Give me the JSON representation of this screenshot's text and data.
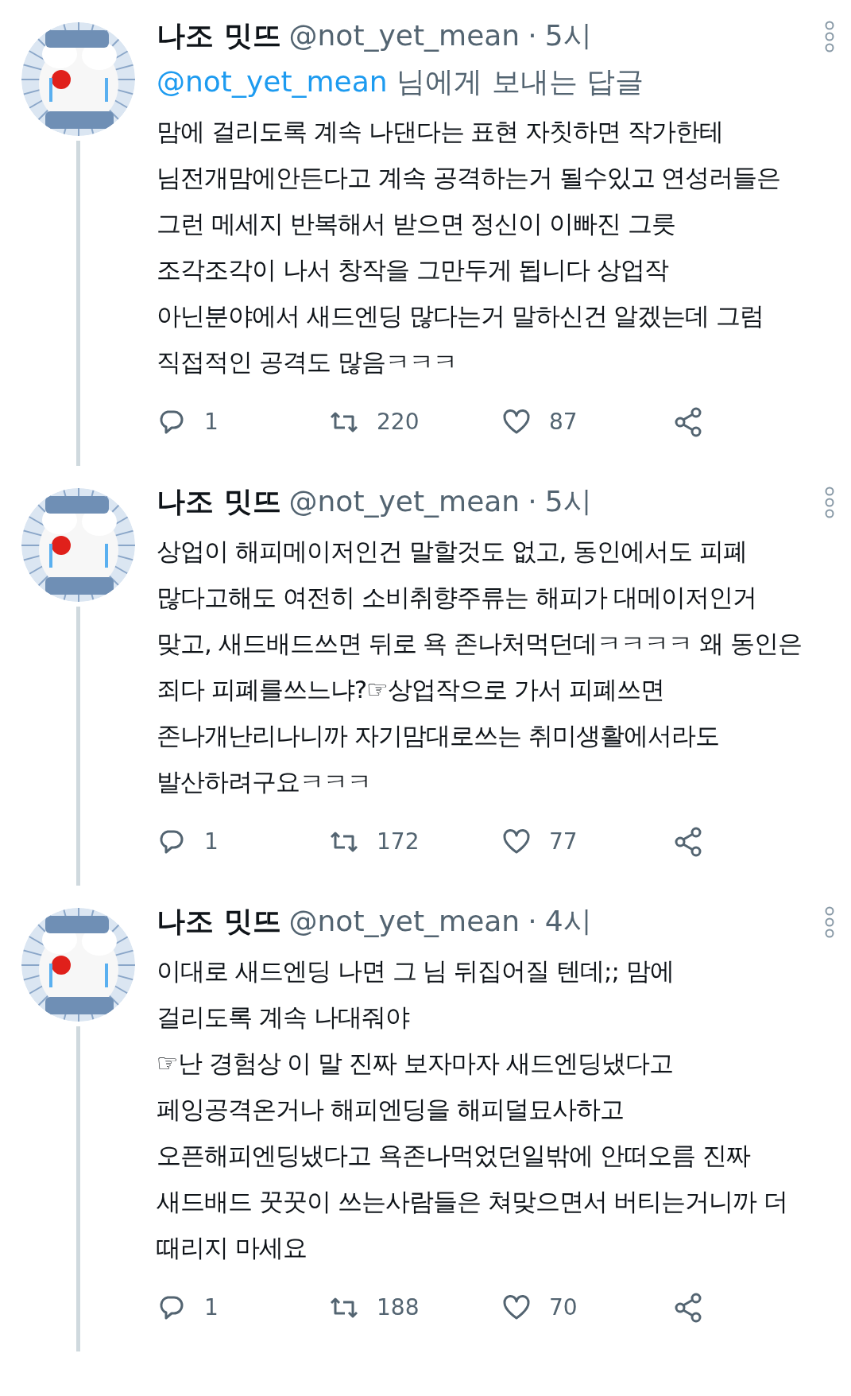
{
  "tweets": [
    {
      "name": "나조 밋뜨",
      "handle": "@not_yet_mean",
      "separator": "·",
      "time": "5시",
      "reply_to": {
        "handle": "@not_yet_mean",
        "text": "님에게 보내는 답글"
      },
      "body": "맘에 걸리도록 계속 나댄다는 표현 자칫하면 작가한테\n님전개맘에안든다고 계속 공격하는거 될수있고 연성러들은\n그런 메세지 반복해서 받으면 정신이 이빠진 그릇\n조각조각이 나서 창작을 그만두게 됩니다 상업작\n아닌분야에서 새드엔딩 많다는거 말하신건 알겠는데 그럼\n직접적인 공격도 많음ㅋㅋㅋ",
      "replies": "1",
      "retweets": "220",
      "likes": "87"
    },
    {
      "name": "나조 밋뜨",
      "handle": "@not_yet_mean",
      "separator": "·",
      "time": "5시",
      "body": "상업이 해피메이저인건 말할것도 없고, 동인에서도 피폐\n많다고해도 여전히 소비취향주류는 해피가 대메이저인거\n맞고, 새드배드쓰면 뒤로 욕 존나처먹던데ㅋㅋㅋㅋ 왜 동인은\n죄다 피폐를쓰느냐?☞상업작으로 가서 피폐쓰면\n존나개난리나니까 자기맘대로쓰는 취미생활에서라도\n발산하려구요ㅋㅋㅋ",
      "replies": "1",
      "retweets": "172",
      "likes": "77"
    },
    {
      "name": "나조 밋뜨",
      "handle": "@not_yet_mean",
      "separator": "·",
      "time": "4시",
      "body": "이대로 새드엔딩 나면 그 님 뒤집어질 텐데;; 맘에\n걸리도록 계속 나대줘야\n☞난 경험상 이 말 진짜 보자마자 새드엔딩냈다고\n페잉공격온거나 해피엔딩을 해피덜묘사하고\n오픈해피엔딩냈다고 욕존나먹었던일밖에 안떠오름 진짜\n새드배드 꿋꿋이 쓰는사람들은 쳐맞으면서 버티는거니까 더\n때리지 마세요",
      "replies": "1",
      "retweets": "188",
      "likes": "70"
    }
  ]
}
